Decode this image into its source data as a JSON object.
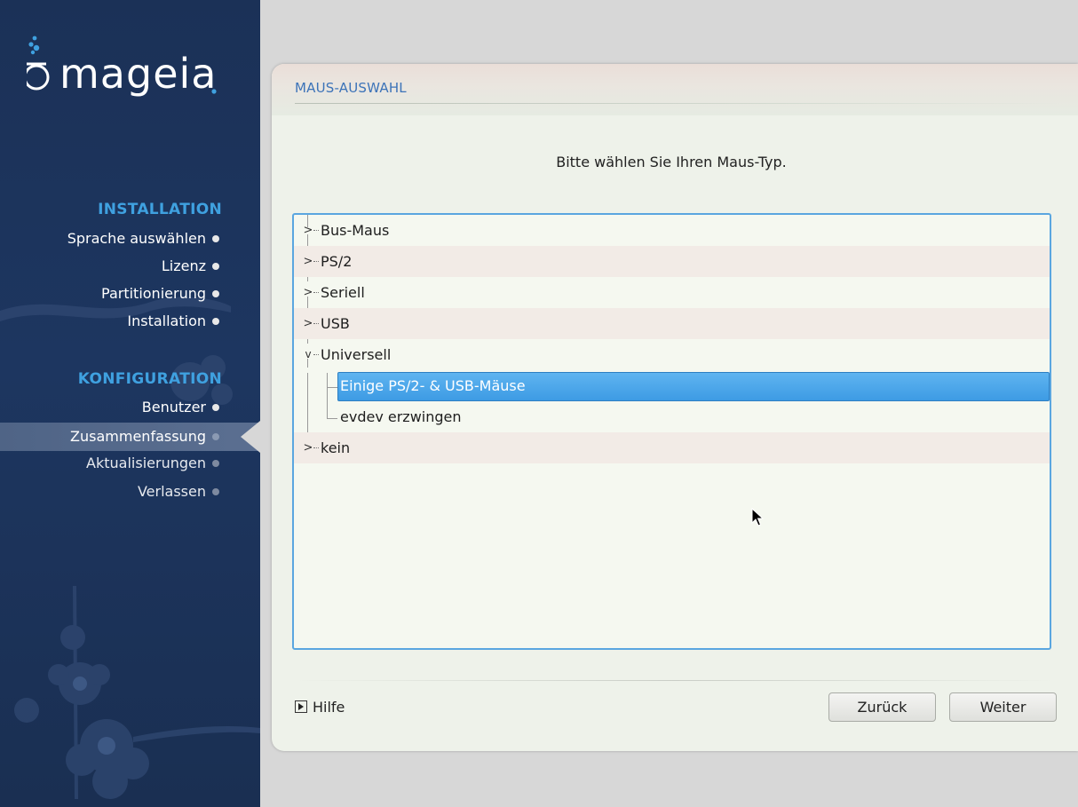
{
  "brand": {
    "logo_text": "mageia"
  },
  "sidebar": {
    "sections": [
      {
        "heading": "INSTALLATION",
        "items": [
          {
            "label": "Sprache auswählen",
            "state": "done"
          },
          {
            "label": "Lizenz",
            "state": "done"
          },
          {
            "label": "Partitionierung",
            "state": "done"
          },
          {
            "label": "Installation",
            "state": "done"
          }
        ]
      },
      {
        "heading": "KONFIGURATION",
        "items": [
          {
            "label": "Benutzer",
            "state": "done"
          },
          {
            "label": "Zusammenfassung",
            "state": "active"
          },
          {
            "label": "Aktualisierungen",
            "state": "pending"
          },
          {
            "label": "Verlassen",
            "state": "pending"
          }
        ]
      }
    ]
  },
  "main": {
    "title": "MAUS-AUSWAHL",
    "instruction": "Bitte wählen Sie Ihren Maus-Typ.",
    "tree": [
      {
        "label": "Bus-Maus",
        "expanded": false
      },
      {
        "label": "PS/2",
        "expanded": false
      },
      {
        "label": "Seriell",
        "expanded": false
      },
      {
        "label": "USB",
        "expanded": false
      },
      {
        "label": "Universell",
        "expanded": true,
        "children": [
          {
            "label": "Einige PS/2- & USB-Mäuse",
            "selected": true
          },
          {
            "label": "evdev erzwingen",
            "selected": false
          }
        ]
      },
      {
        "label": "kein",
        "expanded": false
      }
    ],
    "help_label": "Hilfe",
    "back_label": "Zurück",
    "next_label": "Weiter"
  },
  "colors": {
    "sidebar_bg": "#1b3157",
    "heading": "#3fa1e0",
    "selection": "#3d9be4",
    "title": "#3c73b8"
  }
}
